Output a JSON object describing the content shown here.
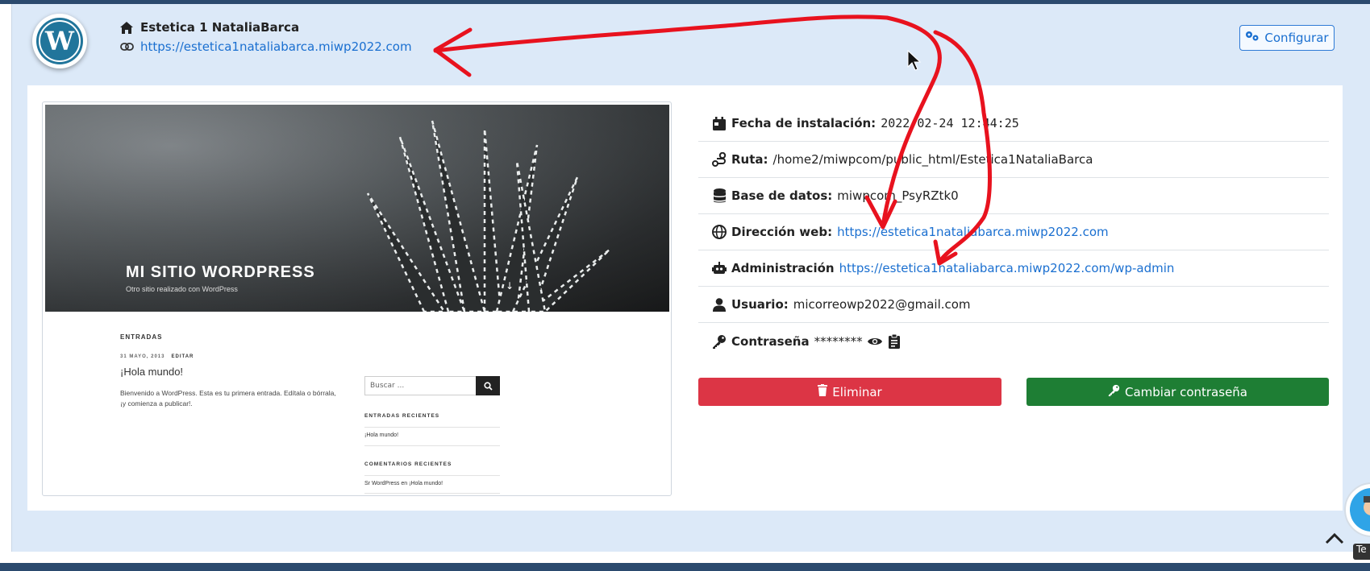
{
  "header": {
    "site_name": "Estetica 1 NataliaBarca",
    "site_url": "https://estetica1nataliabarca.miwp2022.com",
    "config_label": "Configurar"
  },
  "preview": {
    "hero_title": "MI SITIO WORDPRESS",
    "hero_subtitle": "Otro sitio realizado con WordPress",
    "hero_arrow": "↓",
    "section_label": "ENTRADAS",
    "post_meta": "31 MAYO, 2013",
    "post_edit": "EDITAR",
    "post_title": "¡Hola mundo!",
    "post_excerpt": "Bienvenido a WordPress. Esta es tu primera entrada. Edítala o bórrala, ¡y comienza a publicar!.",
    "search_placeholder": "Buscar ...",
    "recent_posts_label": "ENTRADAS RECIENTES",
    "recent_post_item": "¡Hola mundo!",
    "recent_comments_label": "COMENTARIOS RECIENTES",
    "recent_comment_item": "Sr WordPress en ¡Hola mundo!"
  },
  "info": {
    "install_date_label": "Fecha de instalación:",
    "install_date_value": "2022-02-24 12:44:25",
    "path_label": "Ruta:",
    "path_value": "/home2/miwpcom/public_html/Estetica1NataliaBarca",
    "db_label": "Base de datos:",
    "db_value": "miwpcom_PsyRZtk0",
    "web_label": "Dirección web:",
    "web_value": "https://estetica1nataliabarca.miwp2022.com",
    "admin_label": "Administración",
    "admin_value": "https://estetica1nataliabarca.miwp2022.com/wp-admin",
    "user_label": "Usuario:",
    "user_value": "micorreowp2022@gmail.com",
    "password_label": "Contraseña",
    "password_value": "********"
  },
  "actions": {
    "delete_label": "Eliminar",
    "change_password_label": "Cambiar contraseña"
  },
  "misc": {
    "tooltip_text": "Te"
  },
  "colors": {
    "link": "#1a6fd0",
    "danger": "#dc3545",
    "success": "#1e7e34",
    "header_bg": "#dce9f8",
    "annotation": "#e8121e"
  }
}
